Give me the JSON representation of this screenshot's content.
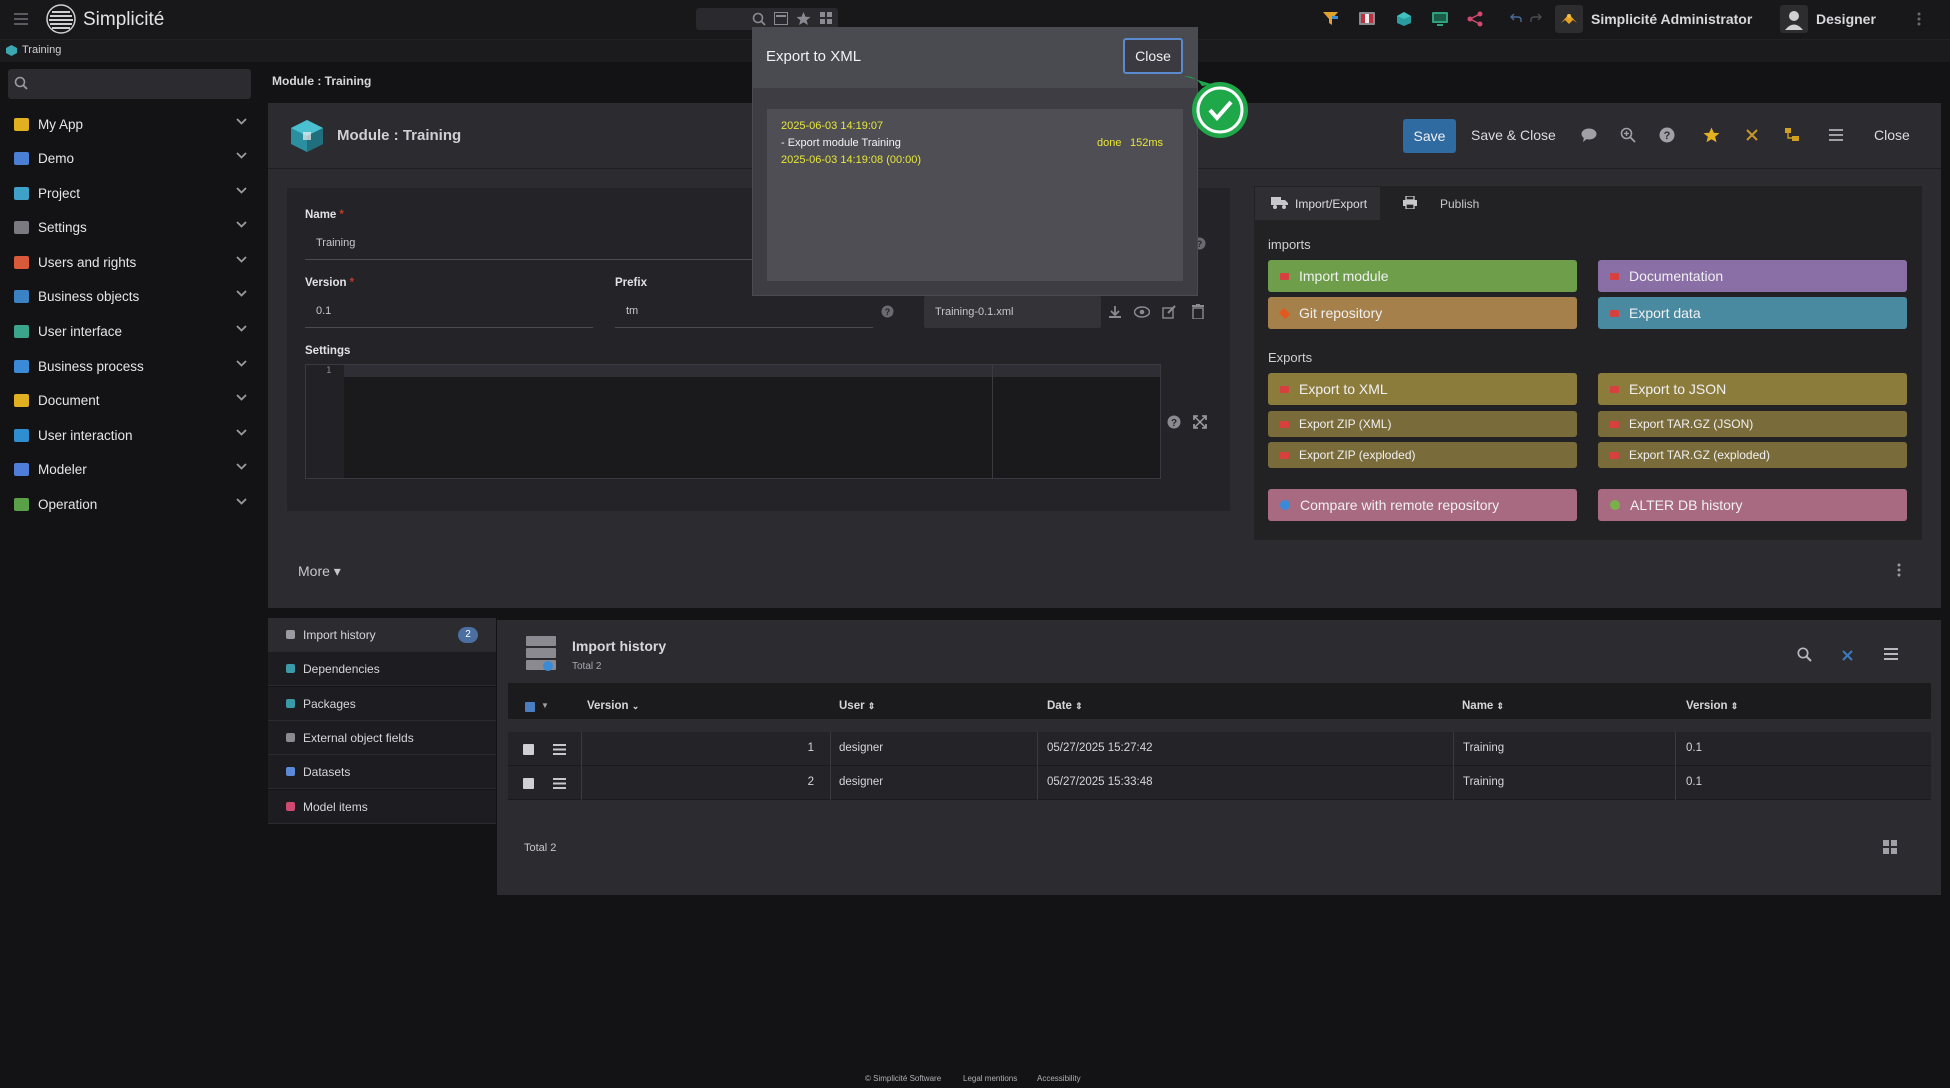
{
  "app": {
    "name": "Simplicité",
    "user_group": "Simplicité Administrator",
    "user": "Designer"
  },
  "breadcrumb": "Training",
  "page_breadcrumb": "Module : Training",
  "sidebar": {
    "items": [
      {
        "label": "My App",
        "color": "#e0b020"
      },
      {
        "label": "Demo",
        "color": "#4a7fd4"
      },
      {
        "label": "Project",
        "color": "#3fa0c8"
      },
      {
        "label": "Settings",
        "color": "#7a7a80"
      },
      {
        "label": "Users and rights",
        "color": "#d85a3a"
      },
      {
        "label": "Business objects",
        "color": "#3b82c4"
      },
      {
        "label": "User interface",
        "color": "#3aa58a"
      },
      {
        "label": "Business process",
        "color": "#3a8ad8"
      },
      {
        "label": "Document",
        "color": "#e0b020"
      },
      {
        "label": "User interaction",
        "color": "#2f8ed0"
      },
      {
        "label": "Modeler",
        "color": "#4f7ed8"
      },
      {
        "label": "Operation",
        "color": "#5aa048"
      }
    ]
  },
  "form": {
    "title": "Module : Training",
    "actions": {
      "save": "Save",
      "save_close": "Save & Close",
      "close": "Close"
    },
    "name_label": "Name",
    "name_value": "Training",
    "version_label": "Version",
    "version_value": "0.1",
    "prefix_label": "Prefix",
    "prefix_value": "tm",
    "file_value": "Training-0.1.xml",
    "settings_label": "Settings",
    "settings_line": "1",
    "more": "More"
  },
  "import_export": {
    "tab_import_export": "Import/Export",
    "tab_publish": "Publish",
    "imports_title": "imports",
    "exports_title": "Exports",
    "import_module": "Import module",
    "documentation": "Documentation",
    "git_repository": "Git repository",
    "export_data": "Export data",
    "export_xml": "Export to XML",
    "export_json": "Export to JSON",
    "export_zip_xml": "Export ZIP (XML)",
    "export_targz_json": "Export TAR.GZ (JSON)",
    "export_zip_exploded": "Export ZIP (exploded)",
    "export_targz_exploded": "Export TAR.GZ (exploded)",
    "compare_remote": "Compare with remote repository",
    "alter_db": "ALTER DB history"
  },
  "modal": {
    "title": "Export to XML",
    "close": "Close",
    "log_line1": "2025-06-03 14:19:07",
    "log_line2": "- Export module Training",
    "log_done": "done",
    "log_time": "152ms",
    "log_line3": "2025-06-03 14:19:08 (00:00)"
  },
  "links": {
    "items": [
      {
        "label": "Import history",
        "badge": "2"
      },
      {
        "label": "Dependencies"
      },
      {
        "label": "Packages"
      },
      {
        "label": "External object fields"
      },
      {
        "label": "Datasets"
      },
      {
        "label": "Model items"
      }
    ]
  },
  "history": {
    "title": "Import history",
    "subtitle": "Total 2",
    "columns": [
      "Version",
      "User",
      "Date",
      "Name",
      "Version"
    ],
    "rows": [
      {
        "num": "1",
        "user": "designer",
        "date": "05/27/2025 15:27:42",
        "name": "Training",
        "version": "0.1"
      },
      {
        "num": "2",
        "user": "designer",
        "date": "05/27/2025 15:33:48",
        "name": "Training",
        "version": "0.1"
      }
    ],
    "footer": "Total 2"
  },
  "footer": {
    "copyright": "© Simplicité Software",
    "legal": "Legal mentions",
    "accessibility": "Accessibility"
  }
}
